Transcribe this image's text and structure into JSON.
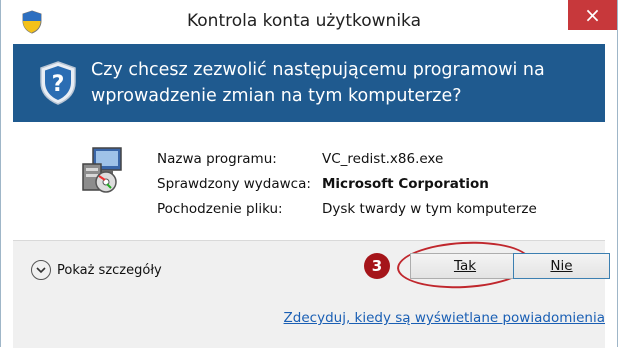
{
  "window": {
    "title": "Kontrola konta użytkownika",
    "close_glyph": "×"
  },
  "banner": {
    "question": "Czy chcesz zezwolić następującemu programowi na wprowadzenie zmian na tym komputerze?",
    "icon": "uac-shield-icon",
    "color": "#1f5a8f"
  },
  "details": {
    "program_label": "Nazwa programu:",
    "program_value": "VC_redist.x86.exe",
    "publisher_label": "Sprawdzony wydawca:",
    "publisher_value": "Microsoft Corporation",
    "origin_label": "Pochodzenie pliku:",
    "origin_value": "Dysk twardy w tym komputerze",
    "icon": "installer-program-icon"
  },
  "footer": {
    "show_details": "Pokaż szczegóły",
    "step_marker": "3",
    "yes_label": "Tak",
    "no_label": "Nie",
    "notifications_link": "Zdecyduj, kiedy są wyświetlane powiadomienia"
  },
  "colors": {
    "close": "#c7383b",
    "marker": "#a5151a",
    "link": "#1a5fb4"
  }
}
